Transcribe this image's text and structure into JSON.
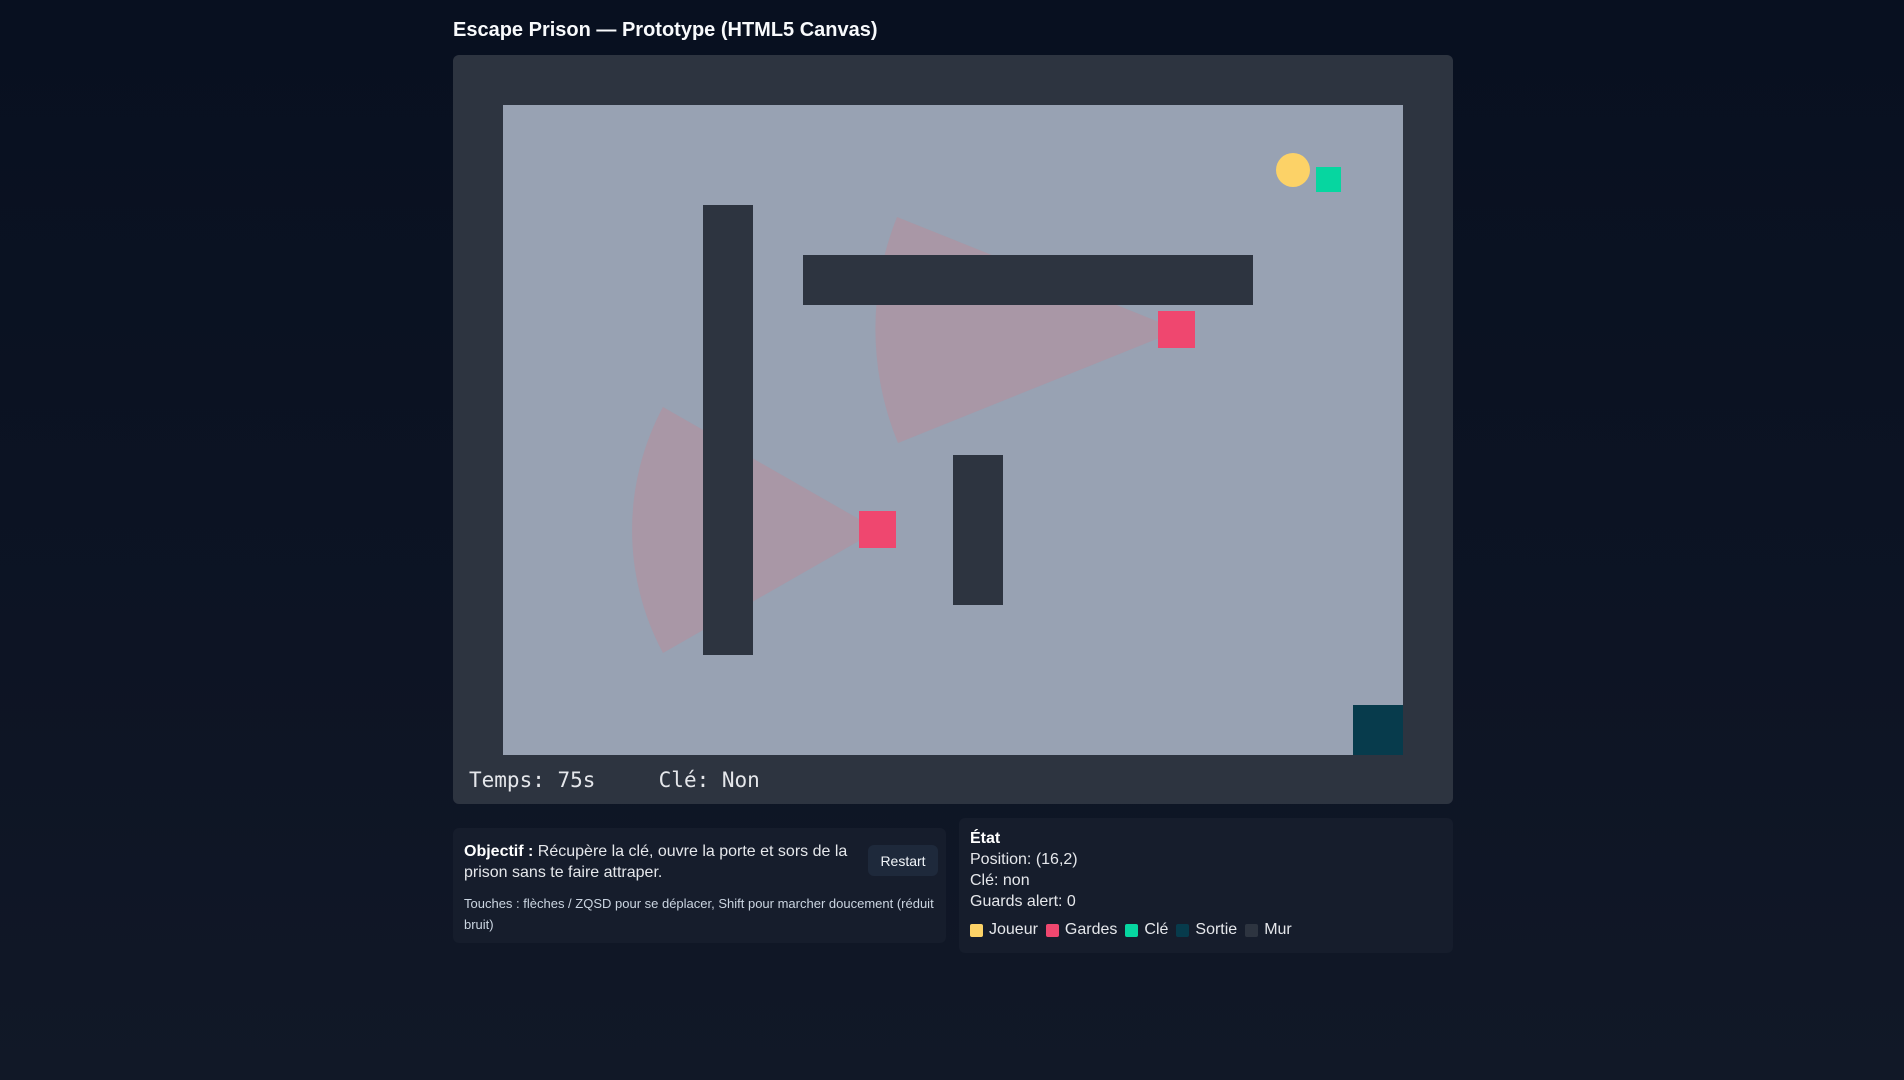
{
  "title": "Escape Prison — Prototype (HTML5 Canvas)",
  "hud": {
    "time": "Temps: 75s",
    "key": "Clé: Non"
  },
  "objective": {
    "label": "Objectif :",
    "text": "Récupère la clé, ouvre la porte et sors de la prison sans te faire attraper.",
    "controls": "Touches : flèches / ZQSD pour se déplacer, Shift pour marcher doucement (réduit bruit)",
    "restart_label": "Restart"
  },
  "state": {
    "title": "État",
    "position": "Position: (16,2)",
    "key": "Clé: non",
    "alert": "Guards alert: 0"
  },
  "legend": [
    {
      "label": "Joueur",
      "color": "#fcd267"
    },
    {
      "label": "Gardes",
      "color": "#ef476f"
    },
    {
      "label": "Clé",
      "color": "#06d6a0"
    },
    {
      "label": "Sortie",
      "color": "#073b4c"
    },
    {
      "label": "Mur",
      "color": "#2d3440"
    }
  ],
  "colors": {
    "floor": "#98a2b3",
    "wall": "#2d3440",
    "vision_cone": "#b98c99"
  }
}
